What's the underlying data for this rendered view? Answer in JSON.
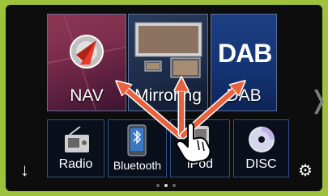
{
  "tiles": {
    "nav": "NAV",
    "mirroring": "Mirroring",
    "dab": "DAB",
    "dab_logo": "DAB"
  },
  "sources": {
    "radio": "Radio",
    "bluetooth": "Bluetooth",
    "ipod": "iPod",
    "disc": "DISC"
  },
  "icons": {
    "next_page": "chevron-right-icon",
    "down": "down-arrow-icon",
    "settings": "gear-icon",
    "swipe": "hand-pointer-icon"
  },
  "colors": {
    "frame": "#9ec23c",
    "swipe_arrow": "#e9623d",
    "tile_border": "#5c6f9a"
  },
  "pager": {
    "pages": 3,
    "current": 2
  }
}
